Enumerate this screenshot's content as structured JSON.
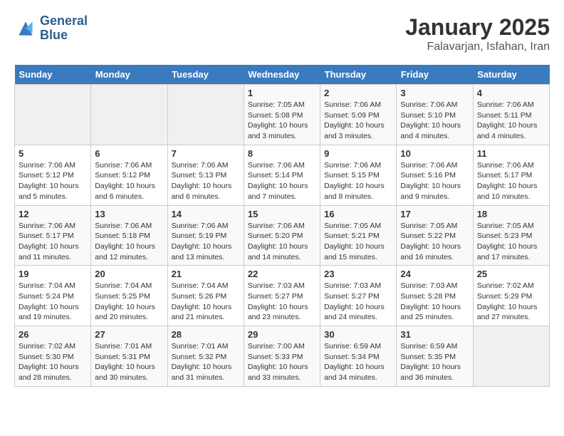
{
  "header": {
    "logo_line1": "General",
    "logo_line2": "Blue",
    "month_title": "January 2025",
    "location": "Falavarjan, Isfahan, Iran"
  },
  "weekdays": [
    "Sunday",
    "Monday",
    "Tuesday",
    "Wednesday",
    "Thursday",
    "Friday",
    "Saturday"
  ],
  "weeks": [
    [
      {
        "num": "",
        "sunrise": "",
        "sunset": "",
        "daylight": "",
        "empty": true
      },
      {
        "num": "",
        "sunrise": "",
        "sunset": "",
        "daylight": "",
        "empty": true
      },
      {
        "num": "",
        "sunrise": "",
        "sunset": "",
        "daylight": "",
        "empty": true
      },
      {
        "num": "1",
        "sunrise": "Sunrise: 7:05 AM",
        "sunset": "Sunset: 5:08 PM",
        "daylight": "Daylight: 10 hours and 3 minutes."
      },
      {
        "num": "2",
        "sunrise": "Sunrise: 7:06 AM",
        "sunset": "Sunset: 5:09 PM",
        "daylight": "Daylight: 10 hours and 3 minutes."
      },
      {
        "num": "3",
        "sunrise": "Sunrise: 7:06 AM",
        "sunset": "Sunset: 5:10 PM",
        "daylight": "Daylight: 10 hours and 4 minutes."
      },
      {
        "num": "4",
        "sunrise": "Sunrise: 7:06 AM",
        "sunset": "Sunset: 5:11 PM",
        "daylight": "Daylight: 10 hours and 4 minutes."
      }
    ],
    [
      {
        "num": "5",
        "sunrise": "Sunrise: 7:06 AM",
        "sunset": "Sunset: 5:12 PM",
        "daylight": "Daylight: 10 hours and 5 minutes."
      },
      {
        "num": "6",
        "sunrise": "Sunrise: 7:06 AM",
        "sunset": "Sunset: 5:12 PM",
        "daylight": "Daylight: 10 hours and 6 minutes."
      },
      {
        "num": "7",
        "sunrise": "Sunrise: 7:06 AM",
        "sunset": "Sunset: 5:13 PM",
        "daylight": "Daylight: 10 hours and 6 minutes."
      },
      {
        "num": "8",
        "sunrise": "Sunrise: 7:06 AM",
        "sunset": "Sunset: 5:14 PM",
        "daylight": "Daylight: 10 hours and 7 minutes."
      },
      {
        "num": "9",
        "sunrise": "Sunrise: 7:06 AM",
        "sunset": "Sunset: 5:15 PM",
        "daylight": "Daylight: 10 hours and 8 minutes."
      },
      {
        "num": "10",
        "sunrise": "Sunrise: 7:06 AM",
        "sunset": "Sunset: 5:16 PM",
        "daylight": "Daylight: 10 hours and 9 minutes."
      },
      {
        "num": "11",
        "sunrise": "Sunrise: 7:06 AM",
        "sunset": "Sunset: 5:17 PM",
        "daylight": "Daylight: 10 hours and 10 minutes."
      }
    ],
    [
      {
        "num": "12",
        "sunrise": "Sunrise: 7:06 AM",
        "sunset": "Sunset: 5:17 PM",
        "daylight": "Daylight: 10 hours and 11 minutes."
      },
      {
        "num": "13",
        "sunrise": "Sunrise: 7:06 AM",
        "sunset": "Sunset: 5:18 PM",
        "daylight": "Daylight: 10 hours and 12 minutes."
      },
      {
        "num": "14",
        "sunrise": "Sunrise: 7:06 AM",
        "sunset": "Sunset: 5:19 PM",
        "daylight": "Daylight: 10 hours and 13 minutes."
      },
      {
        "num": "15",
        "sunrise": "Sunrise: 7:06 AM",
        "sunset": "Sunset: 5:20 PM",
        "daylight": "Daylight: 10 hours and 14 minutes."
      },
      {
        "num": "16",
        "sunrise": "Sunrise: 7:05 AM",
        "sunset": "Sunset: 5:21 PM",
        "daylight": "Daylight: 10 hours and 15 minutes."
      },
      {
        "num": "17",
        "sunrise": "Sunrise: 7:05 AM",
        "sunset": "Sunset: 5:22 PM",
        "daylight": "Daylight: 10 hours and 16 minutes."
      },
      {
        "num": "18",
        "sunrise": "Sunrise: 7:05 AM",
        "sunset": "Sunset: 5:23 PM",
        "daylight": "Daylight: 10 hours and 17 minutes."
      }
    ],
    [
      {
        "num": "19",
        "sunrise": "Sunrise: 7:04 AM",
        "sunset": "Sunset: 5:24 PM",
        "daylight": "Daylight: 10 hours and 19 minutes."
      },
      {
        "num": "20",
        "sunrise": "Sunrise: 7:04 AM",
        "sunset": "Sunset: 5:25 PM",
        "daylight": "Daylight: 10 hours and 20 minutes."
      },
      {
        "num": "21",
        "sunrise": "Sunrise: 7:04 AM",
        "sunset": "Sunset: 5:26 PM",
        "daylight": "Daylight: 10 hours and 21 minutes."
      },
      {
        "num": "22",
        "sunrise": "Sunrise: 7:03 AM",
        "sunset": "Sunset: 5:27 PM",
        "daylight": "Daylight: 10 hours and 23 minutes."
      },
      {
        "num": "23",
        "sunrise": "Sunrise: 7:03 AM",
        "sunset": "Sunset: 5:27 PM",
        "daylight": "Daylight: 10 hours and 24 minutes."
      },
      {
        "num": "24",
        "sunrise": "Sunrise: 7:03 AM",
        "sunset": "Sunset: 5:28 PM",
        "daylight": "Daylight: 10 hours and 25 minutes."
      },
      {
        "num": "25",
        "sunrise": "Sunrise: 7:02 AM",
        "sunset": "Sunset: 5:29 PM",
        "daylight": "Daylight: 10 hours and 27 minutes."
      }
    ],
    [
      {
        "num": "26",
        "sunrise": "Sunrise: 7:02 AM",
        "sunset": "Sunset: 5:30 PM",
        "daylight": "Daylight: 10 hours and 28 minutes."
      },
      {
        "num": "27",
        "sunrise": "Sunrise: 7:01 AM",
        "sunset": "Sunset: 5:31 PM",
        "daylight": "Daylight: 10 hours and 30 minutes."
      },
      {
        "num": "28",
        "sunrise": "Sunrise: 7:01 AM",
        "sunset": "Sunset: 5:32 PM",
        "daylight": "Daylight: 10 hours and 31 minutes."
      },
      {
        "num": "29",
        "sunrise": "Sunrise: 7:00 AM",
        "sunset": "Sunset: 5:33 PM",
        "daylight": "Daylight: 10 hours and 33 minutes."
      },
      {
        "num": "30",
        "sunrise": "Sunrise: 6:59 AM",
        "sunset": "Sunset: 5:34 PM",
        "daylight": "Daylight: 10 hours and 34 minutes."
      },
      {
        "num": "31",
        "sunrise": "Sunrise: 6:59 AM",
        "sunset": "Sunset: 5:35 PM",
        "daylight": "Daylight: 10 hours and 36 minutes."
      },
      {
        "num": "",
        "sunrise": "",
        "sunset": "",
        "daylight": "",
        "empty": true
      }
    ]
  ]
}
